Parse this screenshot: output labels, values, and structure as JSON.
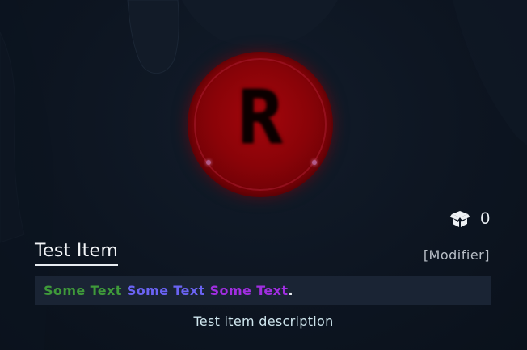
{
  "item": {
    "icon_letter": "R",
    "title": "Test Item",
    "modifier": "[Modifier]",
    "description": "Test item description"
  },
  "stack": {
    "icon": "open-box-icon",
    "count": "0"
  },
  "rich_text": [
    {
      "text": "Some Text",
      "color": "#3f9a3a"
    },
    {
      "text": " "
    },
    {
      "text": "Some Text",
      "color": "#6a63f2"
    },
    {
      "text": " "
    },
    {
      "text": "Some Text",
      "color": "#a02ee0"
    },
    {
      "text": ".",
      "color": "#e8ecf1"
    }
  ],
  "colors": {
    "icon_red": "#8a0308",
    "background": "#0d1622",
    "text_bar": "#1a2434"
  }
}
